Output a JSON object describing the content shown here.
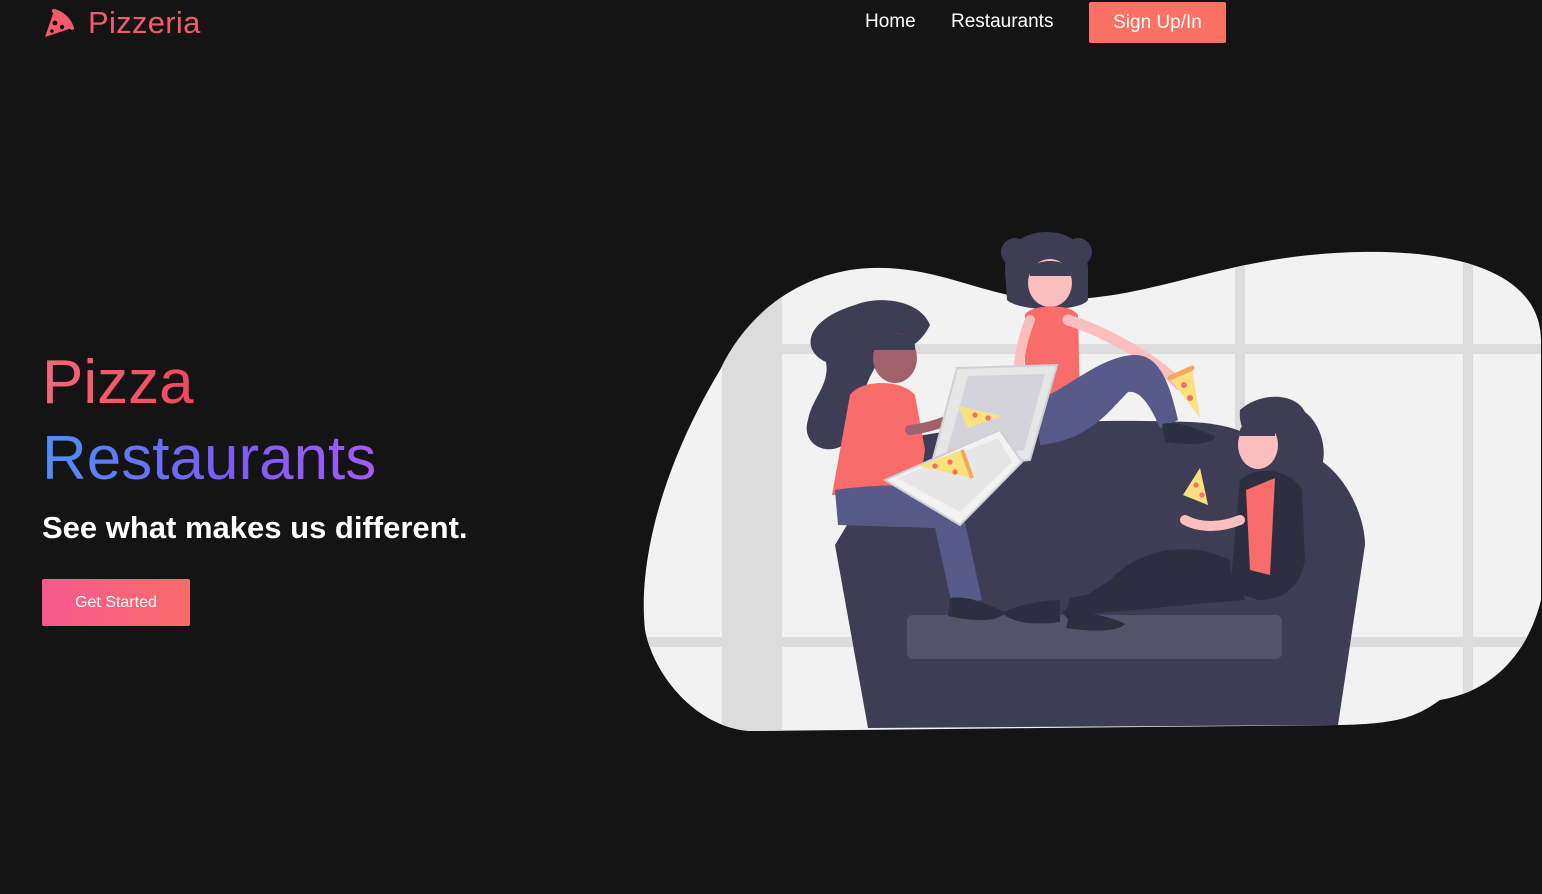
{
  "nav": {
    "brand": "Pizzeria",
    "links": [
      "Home",
      "Restaurants"
    ],
    "cta": "Sign Up/In"
  },
  "hero": {
    "title_line1": "Pizza",
    "title_line2": "Restaurants",
    "subtitle": "See what makes us different.",
    "cta": "Get Started"
  },
  "icons": {
    "logo": "pizza-slice-icon"
  },
  "colors": {
    "background": "#141414",
    "brand": "#f25b6c",
    "nav_cta": "#f87162",
    "hero_cta_start": "#f8588f",
    "hero_cta_end": "#f86c6a",
    "title_pink": "#f2465d",
    "title_blue": "#4f8ff6",
    "title_purple": "#a55bf4"
  }
}
